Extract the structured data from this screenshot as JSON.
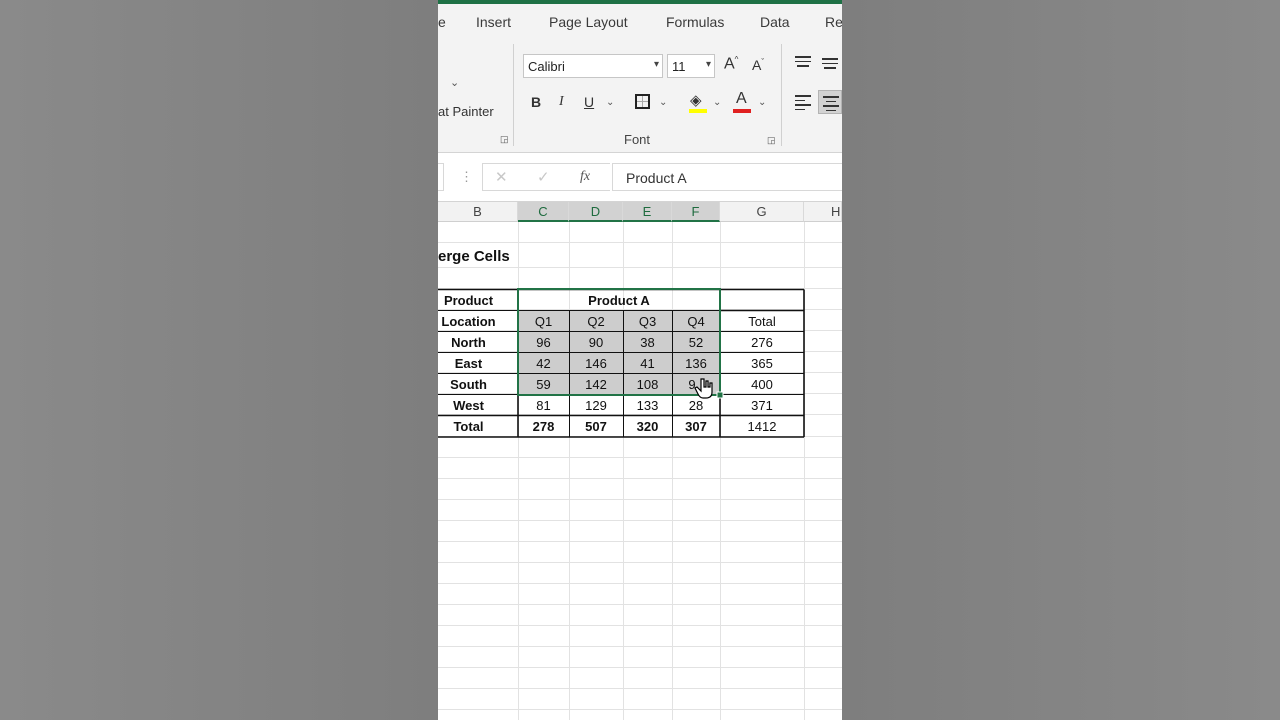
{
  "ribbon_tabs": [
    "e",
    "Insert",
    "Page Layout",
    "Formulas",
    "Data",
    "Re"
  ],
  "clipboard": {
    "format_painter_label": "at Painter"
  },
  "font_group": {
    "font_name": "Calibri",
    "font_size": "11",
    "grow_label": "A",
    "shrink_label": "A",
    "bold": "B",
    "italic": "I",
    "underline": "U",
    "font_color_label": "A",
    "group_label": "Font"
  },
  "formula_bar": {
    "cancel": "✕",
    "enter": "✓",
    "fx": "fx",
    "value": "Product A"
  },
  "columns": [
    "B",
    "C",
    "D",
    "E",
    "F",
    "G",
    "H"
  ],
  "sheet_title": "erge Cells",
  "table": {
    "header_product_label": "Product",
    "header_product_value": "Product A",
    "header_location_label": "Location",
    "quarters": [
      "Q1",
      "Q2",
      "Q3",
      "Q4"
    ],
    "total_label": "Total",
    "rows": [
      {
        "location": "North",
        "values": [
          "96",
          "90",
          "38",
          "52"
        ],
        "total": "276"
      },
      {
        "location": "East",
        "values": [
          "42",
          "146",
          "41",
          "136"
        ],
        "total": "365"
      },
      {
        "location": "South",
        "values": [
          "59",
          "142",
          "108",
          "9"
        ],
        "total": "400"
      },
      {
        "location": "West",
        "values": [
          "81",
          "129",
          "133",
          "28"
        ],
        "total": "371"
      }
    ],
    "totals_row": {
      "label": "Total",
      "values": [
        "278",
        "507",
        "320",
        "307"
      ],
      "total": "1412"
    }
  },
  "colors": {
    "accent_green": "#217346",
    "selection_fill": "#cdcdcd",
    "font_color_bar": "#e02020",
    "fill_color_bar": "#ffff00"
  }
}
